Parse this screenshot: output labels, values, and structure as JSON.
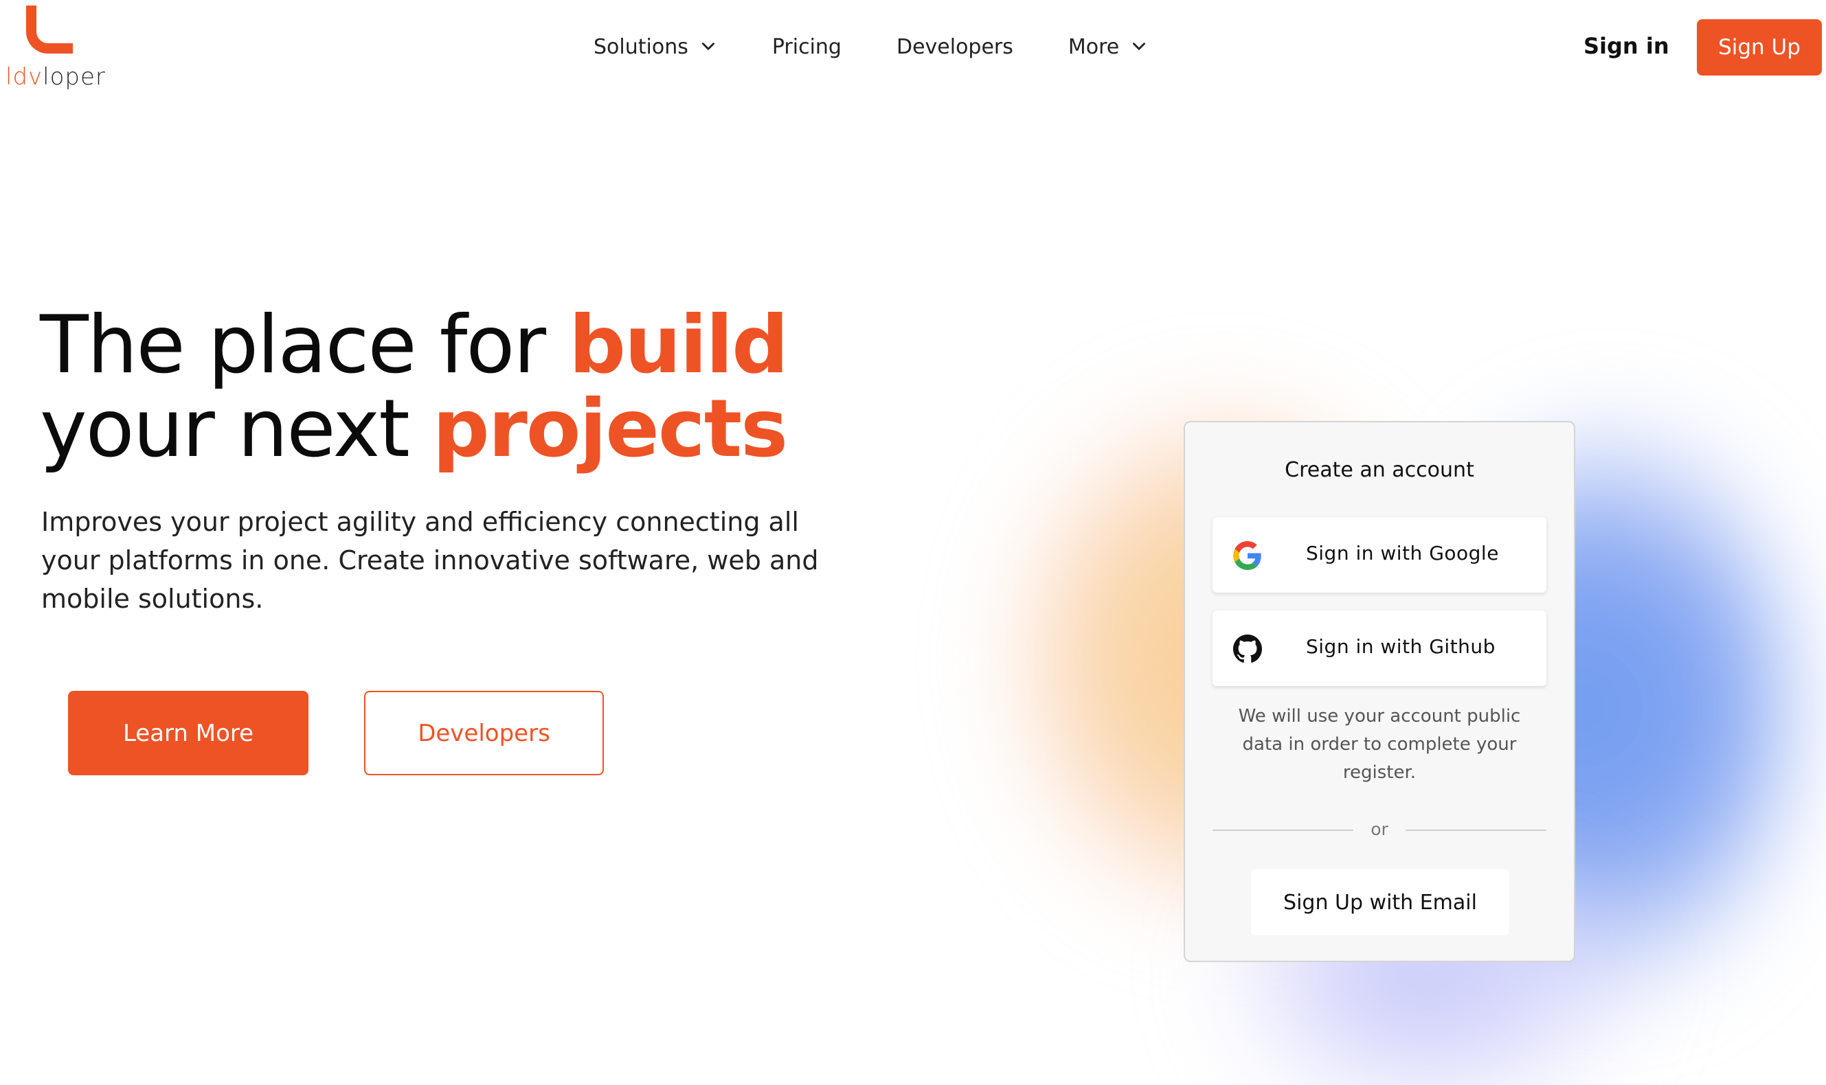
{
  "brand": {
    "logo_prefix": "ldv",
    "logo_suffix": "loper"
  },
  "nav": {
    "items": [
      {
        "label": "Solutions",
        "has_dropdown": true
      },
      {
        "label": "Pricing",
        "has_dropdown": false
      },
      {
        "label": "Developers",
        "has_dropdown": false
      },
      {
        "label": "More",
        "has_dropdown": true
      }
    ],
    "sign_in": "Sign in",
    "sign_up": "Sign Up"
  },
  "hero": {
    "title_part1": "The place for ",
    "title_highlight1": "build",
    "title_part2": " your next ",
    "title_highlight2": "projects",
    "description": "Improves your project agility and efficiency connecting all your platforms in one. Create innovative software, web and mobile solutions.",
    "primary_button": "Learn More",
    "secondary_button": "Developers"
  },
  "signup_card": {
    "title": "Create an account",
    "google_button": "Sign in with Google",
    "github_button": "Sign in with Github",
    "note": "We will use your account public data in order to complete your register.",
    "divider_text": "or",
    "email_button": "Sign Up with Email"
  },
  "colors": {
    "accent": "#ee5325",
    "text": "#111111",
    "card_bg": "#f7f7f7"
  },
  "icons": [
    "chevron-down-icon",
    "google-icon",
    "github-icon"
  ]
}
